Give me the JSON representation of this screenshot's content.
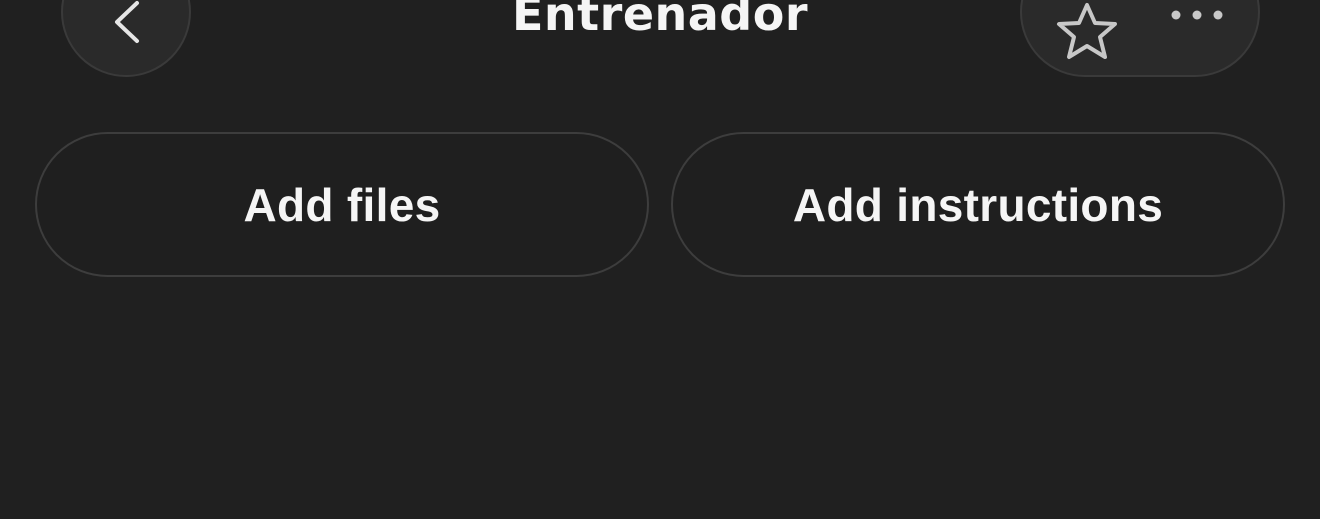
{
  "header": {
    "title": "Entrenador",
    "back_icon": "chevron-left-icon",
    "favorite_icon": "star-icon",
    "more_icon": "more-horizontal-icon"
  },
  "actions": {
    "add_files_label": "Add files",
    "add_instructions_label": "Add instructions"
  },
  "colors": {
    "background": "#202020",
    "surface": "#2a2a2a",
    "border": "#3d3d3d",
    "text": "#f5f5f5",
    "icon": "#c8c8c8"
  }
}
